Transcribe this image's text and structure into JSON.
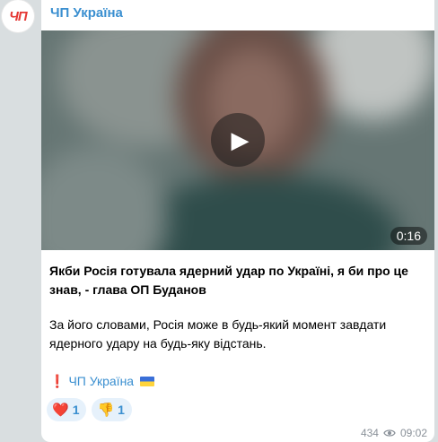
{
  "avatar": {
    "text": "ЧП"
  },
  "channel": {
    "name": "ЧП Україна"
  },
  "video": {
    "duration": "0:16",
    "play_icon": "play-icon"
  },
  "post": {
    "headline": "Якби Росія готувала ядерний удар по Україні, я би про це знав, - глава ОП Буданов",
    "body": "За його словами, Росія може в будь-який момент завдати ядерного удару на будь-яку відстань.",
    "signature_mark": "❗",
    "signature_link": "ЧП Україна",
    "signature_flag": "flag-ukraine-icon"
  },
  "reactions": [
    {
      "emoji": "❤️",
      "icon": "heart-icon",
      "count": "1"
    },
    {
      "emoji": "👎",
      "icon": "thumbs-down-icon",
      "count": "1"
    }
  ],
  "meta": {
    "views": "434",
    "time": "09:02",
    "views_icon": "eye-icon"
  },
  "colors": {
    "accent": "#3a8fd0",
    "brand_red": "#e53935",
    "bubble_bg": "#ffffff",
    "chat_bg": "#d9dee0"
  }
}
